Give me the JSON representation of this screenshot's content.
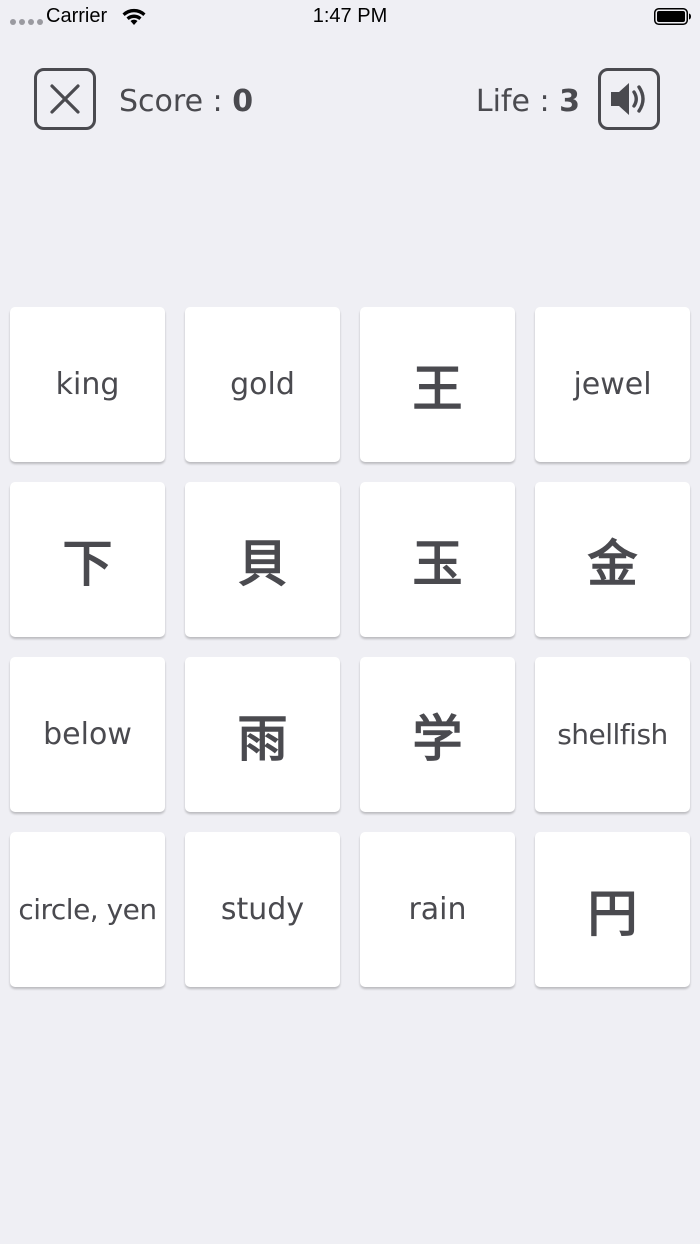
{
  "status_bar": {
    "carrier": "Carrier",
    "time": "1:47 PM"
  },
  "header": {
    "score_label": "Score : ",
    "score_value": "0",
    "life_label": "Life : ",
    "life_value": "3",
    "close_icon": "close-icon",
    "sound_icon": "speaker-icon"
  },
  "cards": [
    {
      "text": "king",
      "kind": "word"
    },
    {
      "text": "gold",
      "kind": "word"
    },
    {
      "text": "王",
      "kind": "kanji"
    },
    {
      "text": "jewel",
      "kind": "word"
    },
    {
      "text": "下",
      "kind": "kanji"
    },
    {
      "text": "貝",
      "kind": "kanji"
    },
    {
      "text": "玉",
      "kind": "kanji"
    },
    {
      "text": "金",
      "kind": "kanji"
    },
    {
      "text": "below",
      "kind": "word"
    },
    {
      "text": "雨",
      "kind": "kanji"
    },
    {
      "text": "学",
      "kind": "kanji"
    },
    {
      "text": "shellfish",
      "kind": "word"
    },
    {
      "text": "circle, yen",
      "kind": "word"
    },
    {
      "text": "study",
      "kind": "word"
    },
    {
      "text": "rain",
      "kind": "word"
    },
    {
      "text": "円",
      "kind": "kanji"
    }
  ]
}
